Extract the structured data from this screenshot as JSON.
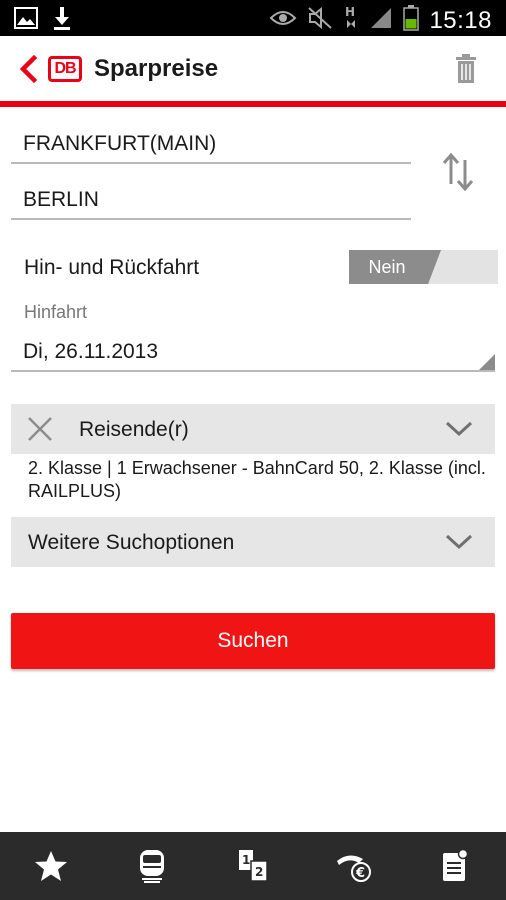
{
  "status_bar": {
    "time": "15:18",
    "icons": [
      "image-icon",
      "download-icon",
      "eye-icon",
      "mute-icon",
      "network-h-icon",
      "signal-icon",
      "battery-icon"
    ],
    "battery_color": "#66bb00"
  },
  "action_bar": {
    "logo": "DB",
    "title": "Sparpreise",
    "icons": [
      "back-chevron-icon",
      "trash-icon"
    ]
  },
  "search": {
    "from": "FRANKFURT(MAIN)",
    "to": "BERLIN",
    "roundtrip_label": "Hin- und Rückfahrt",
    "roundtrip_value": "Nein",
    "hinfahrt_label": "Hinfahrt",
    "hinfahrt_date": "Di, 26.11.2013"
  },
  "travellers": {
    "label": "Reisende(r)",
    "summary": "2. Klasse  |  1 Erwachsener - BahnCard 50, 2. Klasse (incl. RAILPLUS)"
  },
  "options": {
    "label": "Weitere Suchoptionen"
  },
  "search_button": {
    "label": "Suchen"
  },
  "bottom_nav": [
    "star-icon",
    "train-icon",
    "seat-reservation-icon",
    "fare-euro-icon",
    "ticket-list-icon"
  ],
  "colors": {
    "brand_red": "#ec0016",
    "button_red": "#f01414",
    "panel_gray": "#e6e6e6",
    "bottom_bar": "#2b2b2b"
  }
}
